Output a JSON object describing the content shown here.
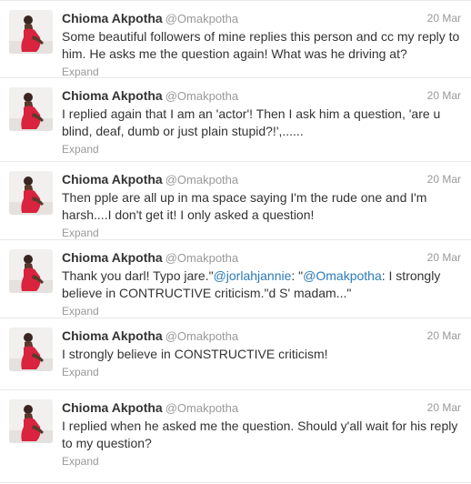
{
  "tweets": [
    {
      "name": "Chioma Akpotha",
      "handle": "@Omakpotha",
      "date": "20 Mar",
      "text_parts": [
        {
          "text": "Some beautiful followers of mine replies this person and cc my reply to him. He asks me the question again! What was he driving at?",
          "type": "plain"
        }
      ],
      "expand": "Expand"
    },
    {
      "name": "Chioma Akpotha",
      "handle": "@Omakpotha",
      "date": "20 Mar",
      "text_parts": [
        {
          "text": "I replied again that I am an 'actor'! Then I ask him a question, 'are u blind, deaf, dumb or just plain stupid?!',......",
          "type": "plain"
        }
      ],
      "expand": "Expand"
    },
    {
      "name": "Chioma Akpotha",
      "handle": "@Omakpotha",
      "date": "20 Mar",
      "text_parts": [
        {
          "text": "Then pple are all up in ma space saying I'm the rude one and I'm harsh....I don't get it! I only asked a question!",
          "type": "plain"
        }
      ],
      "expand": "Expand"
    },
    {
      "name": "Chioma Akpotha",
      "handle": "@Omakpotha",
      "date": "20 Mar",
      "text_parts": [
        {
          "text": "Thank you darl! Typo jare.\"",
          "type": "plain"
        },
        {
          "text": "@jorlahjannie",
          "type": "mention"
        },
        {
          "text": ": \"",
          "type": "plain"
        },
        {
          "text": "@Omakpotha",
          "type": "mention"
        },
        {
          "text": ": I strongly believe in CONTRUCTIVE criticism.\"d S' madam...\"",
          "type": "plain"
        }
      ],
      "expand": "Expand"
    },
    {
      "name": "Chioma Akpotha",
      "handle": "@Omakpotha",
      "date": "20 Mar",
      "text_parts": [
        {
          "text": "I strongly believe in CONSTRUCTIVE criticism!",
          "type": "plain"
        }
      ],
      "expand": "Expand"
    },
    {
      "name": "Chioma Akpotha",
      "handle": "@Omakpotha",
      "date": "20 Mar",
      "text_parts": [
        {
          "text": "I replied when he asked me the question. Should y'all wait for his reply to my question?",
          "type": "plain"
        }
      ],
      "expand": "Expand"
    }
  ],
  "colors": {
    "mention": "#2b7bb9",
    "secondary_text": "#999999",
    "avatar_dress": "#d9233f"
  }
}
